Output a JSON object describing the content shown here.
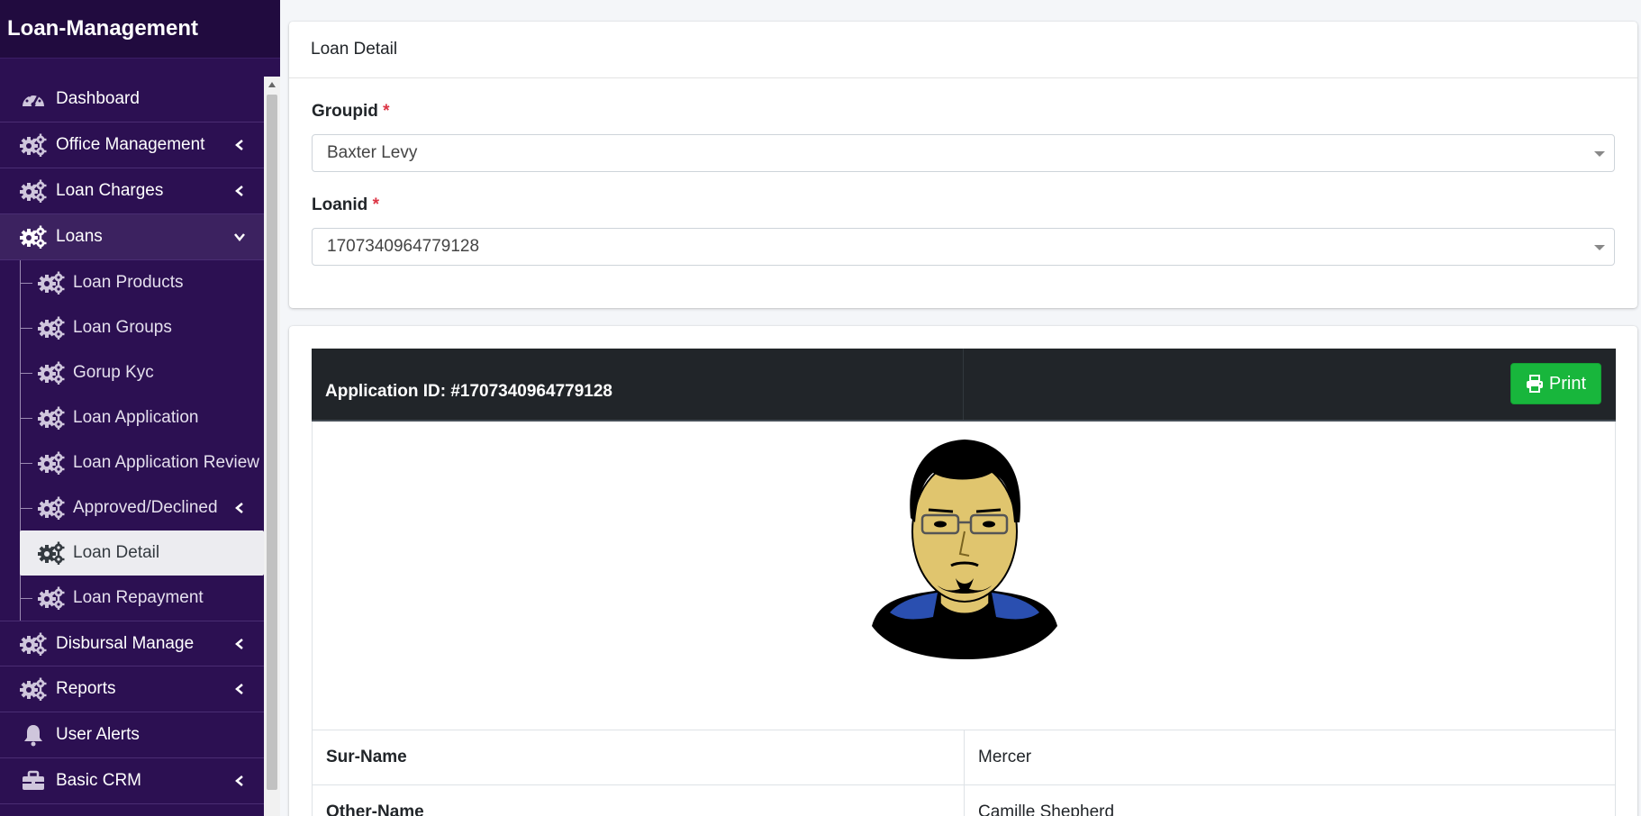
{
  "app": {
    "title": "Loan-Management"
  },
  "sidebar": {
    "dashboard": "Dashboard",
    "office_management": "Office Management",
    "loan_charges": "Loan Charges",
    "loans": "Loans",
    "loan_products": "Loan Products",
    "loan_groups": "Loan Groups",
    "group_kyc": "Gorup Kyc",
    "loan_application": "Loan Application",
    "loan_application_review": "Loan Application Review",
    "approved_declined": "Approved/Declined",
    "loan_detail": "Loan Detail",
    "loan_repayment": "Loan Repayment",
    "disbursal_manage": "Disbursal Manage",
    "reports": "Reports",
    "user_alerts": "User Alerts",
    "basic_crm": "Basic CRM"
  },
  "card": {
    "title": "Loan Detail",
    "groupid_label": "Groupid",
    "groupid_value": "Baxter Levy",
    "loanid_label": "Loanid",
    "loanid_value": "1707340964779128",
    "required_mark": "*"
  },
  "application": {
    "id_label": "Application ID: #1707340964779128",
    "print_label": "Print",
    "rows": [
      {
        "key": "Sur-Name",
        "value": "Mercer"
      },
      {
        "key": "Other-Name",
        "value": "Camille Shepherd"
      }
    ]
  },
  "colors": {
    "sidebar_bg": "#2c1052",
    "brand_bg": "#210b3f",
    "print_button": "#18b63c",
    "table_header": "#212529",
    "required": "#dc3545"
  }
}
